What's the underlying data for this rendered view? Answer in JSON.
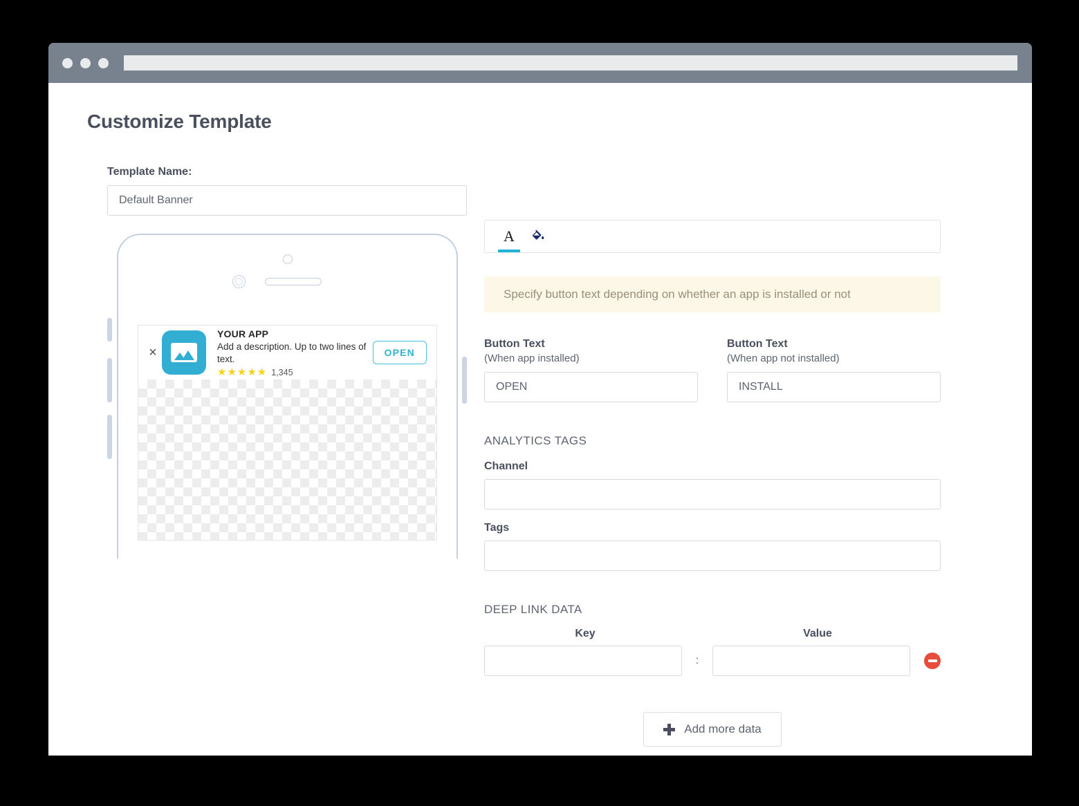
{
  "window": {
    "dots": [
      "close-dot",
      "minimize-dot",
      "maximize-dot"
    ],
    "address_value": ""
  },
  "page": {
    "title": "Customize Template"
  },
  "template_name": {
    "label": "Template Name:",
    "value": "Default Banner",
    "placeholder": "Default Banner"
  },
  "preview": {
    "banner": {
      "close_label": "×",
      "app_name": "YOUR APP",
      "description": "Add a description. Up to two lines of text.",
      "stars": "★★★★★",
      "star_count": 5,
      "rating_count": "1,345",
      "cta_label": "OPEN"
    }
  },
  "tabs": [
    {
      "id": "text-tab",
      "icon": "text-format-icon",
      "glyph": "A",
      "active": true
    },
    {
      "id": "style-tab",
      "icon": "paint-bucket-icon",
      "glyph": "",
      "active": false
    }
  ],
  "hint": {
    "text": "Specify button text depending on whether an app is installed or not"
  },
  "button_text": {
    "installed": {
      "label": "Button Text",
      "sub_label": "(When app installed)",
      "value": "OPEN",
      "placeholder": "OPEN"
    },
    "not_installed": {
      "label": "Button Text",
      "sub_label": "(When app not installed)",
      "value": "INSTALL",
      "placeholder": "INSTALL"
    }
  },
  "analytics": {
    "section_title": "ANALYTICS TAGS",
    "channel": {
      "label": "Channel",
      "value": "",
      "placeholder": ""
    },
    "tags": {
      "label": "Tags",
      "value": "",
      "placeholder": ""
    }
  },
  "deep_link": {
    "section_title": "DEEP LINK DATA",
    "key_header": "Key",
    "value_header": "Value",
    "separator": ":",
    "rows": [
      {
        "key": "",
        "value": "",
        "remove_icon": "remove-circle-icon"
      }
    ],
    "add_button_label": "Add more data"
  },
  "colors": {
    "accent_cyan": "#1eb5d8",
    "app_icon": "#31aed1",
    "titlebar": "#78828f",
    "text_dark": "#4a4f5e",
    "hint_bg": "#fdf7e7",
    "hint_text": "#9a8f77",
    "star_yellow": "#f5d316",
    "remove_red": "#e74c3c",
    "paint_bucket": "#1c2d6b"
  }
}
